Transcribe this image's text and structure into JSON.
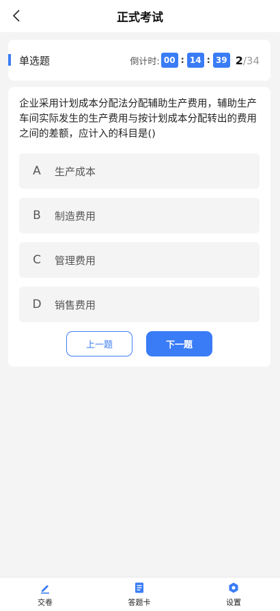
{
  "header": {
    "title": "正式考试"
  },
  "question_bar": {
    "type_label": "单选题",
    "timer_label": "倒计时:",
    "timer": {
      "hours": "00",
      "minutes": "14",
      "seconds": "39",
      "separator": ":"
    },
    "current": "2",
    "total": "/34"
  },
  "question": {
    "text": "企业采用计划成本分配法分配辅助生产费用，辅助生产车间实际发生的生产费用与按计划成本分配转出的费用之间的差额，应计入的科目是()",
    "options": [
      {
        "letter": "A",
        "text": "生产成本"
      },
      {
        "letter": "B",
        "text": "制造费用"
      },
      {
        "letter": "C",
        "text": "管理费用"
      },
      {
        "letter": "D",
        "text": "销售费用"
      }
    ]
  },
  "buttons": {
    "prev": "上一题",
    "next": "下一题"
  },
  "tabbar": {
    "submit": "交卷",
    "answer_card": "答题卡",
    "settings": "设置"
  },
  "colors": {
    "accent": "#3a7cf5",
    "background": "#f4f4f4"
  }
}
